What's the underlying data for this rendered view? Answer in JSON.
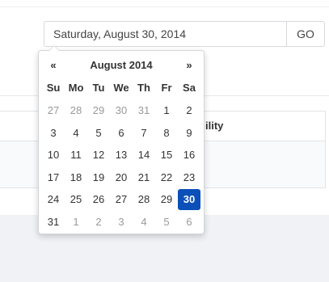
{
  "date_field": {
    "value": "Saturday, August 30, 2014"
  },
  "go_button": {
    "label": "GO"
  },
  "background_table": {
    "partial_header": "ility"
  },
  "datepicker": {
    "prev_label": "«",
    "next_label": "»",
    "month_title": "August 2014",
    "days_of_week": [
      "Su",
      "Mo",
      "Tu",
      "We",
      "Th",
      "Fr",
      "Sa"
    ],
    "weeks": [
      [
        {
          "d": "27",
          "state": "old"
        },
        {
          "d": "28",
          "state": "old"
        },
        {
          "d": "29",
          "state": "old"
        },
        {
          "d": "30",
          "state": "old"
        },
        {
          "d": "31",
          "state": "old"
        },
        {
          "d": "1",
          "state": "cur"
        },
        {
          "d": "2",
          "state": "cur"
        }
      ],
      [
        {
          "d": "3",
          "state": "cur"
        },
        {
          "d": "4",
          "state": "cur"
        },
        {
          "d": "5",
          "state": "cur"
        },
        {
          "d": "6",
          "state": "cur"
        },
        {
          "d": "7",
          "state": "cur"
        },
        {
          "d": "8",
          "state": "cur"
        },
        {
          "d": "9",
          "state": "cur"
        }
      ],
      [
        {
          "d": "10",
          "state": "cur"
        },
        {
          "d": "11",
          "state": "cur"
        },
        {
          "d": "12",
          "state": "cur"
        },
        {
          "d": "13",
          "state": "cur"
        },
        {
          "d": "14",
          "state": "cur"
        },
        {
          "d": "15",
          "state": "cur"
        },
        {
          "d": "16",
          "state": "cur"
        }
      ],
      [
        {
          "d": "17",
          "state": "cur"
        },
        {
          "d": "18",
          "state": "cur"
        },
        {
          "d": "19",
          "state": "cur"
        },
        {
          "d": "20",
          "state": "cur"
        },
        {
          "d": "21",
          "state": "cur"
        },
        {
          "d": "22",
          "state": "cur"
        },
        {
          "d": "23",
          "state": "cur"
        }
      ],
      [
        {
          "d": "24",
          "state": "cur"
        },
        {
          "d": "25",
          "state": "cur"
        },
        {
          "d": "26",
          "state": "cur"
        },
        {
          "d": "27",
          "state": "cur"
        },
        {
          "d": "28",
          "state": "cur"
        },
        {
          "d": "29",
          "state": "cur"
        },
        {
          "d": "30",
          "state": "active"
        }
      ],
      [
        {
          "d": "31",
          "state": "cur"
        },
        {
          "d": "1",
          "state": "old"
        },
        {
          "d": "2",
          "state": "old"
        },
        {
          "d": "3",
          "state": "old"
        },
        {
          "d": "4",
          "state": "old"
        },
        {
          "d": "5",
          "state": "old"
        },
        {
          "d": "6",
          "state": "old"
        }
      ]
    ],
    "colors": {
      "selected_bg": "#0b4fb8",
      "muted_text": "#999999"
    }
  }
}
